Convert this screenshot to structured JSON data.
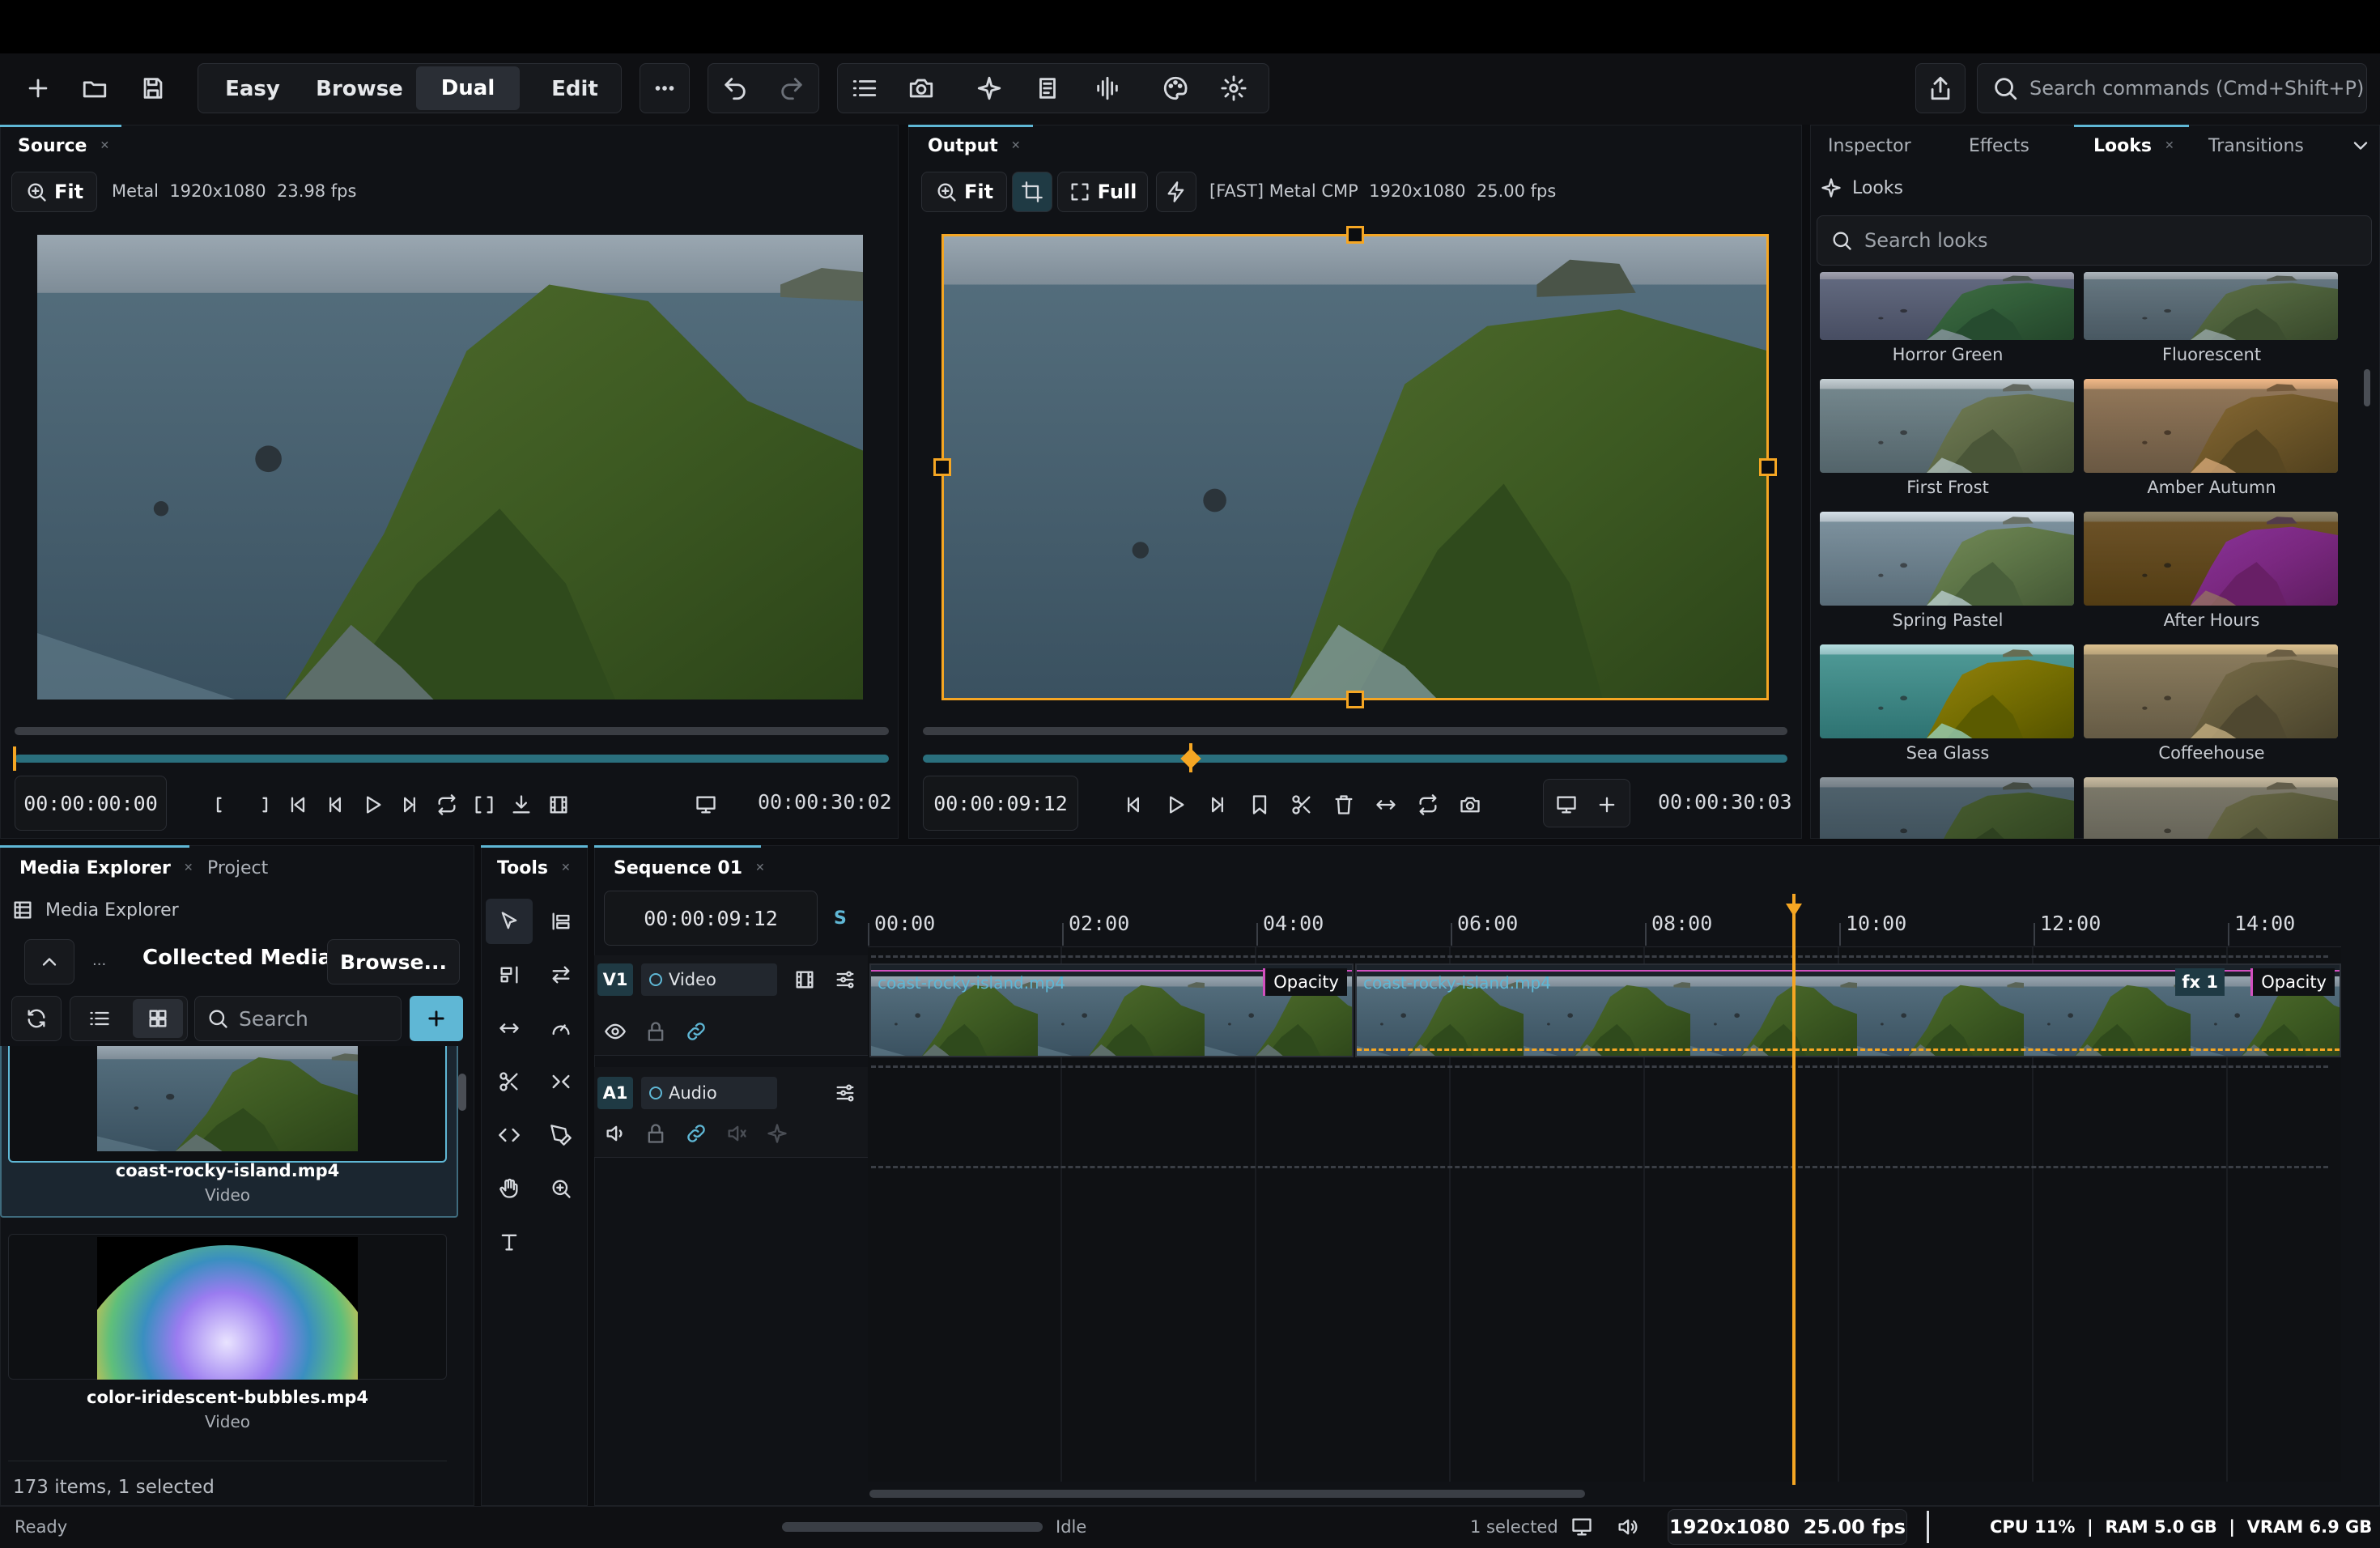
{
  "toolbar": {
    "modes": [
      "Easy",
      "Browse",
      "Dual",
      "Edit"
    ],
    "active_mode": "Dual",
    "search_placeholder": "Search commands (Cmd+Shift+P)"
  },
  "source": {
    "tab": "Source",
    "zoom": "Fit",
    "info": "Metal  1920x1080  23.98 fps",
    "timecode_in": "00:00:00:00",
    "timecode_out": "00:00:30:02"
  },
  "output": {
    "tab": "Output",
    "zoom": "Fit",
    "full": "Full",
    "info": "[FAST] Metal CMP  1920x1080  25.00 fps",
    "timecode_in": "00:00:09:12",
    "timecode_out": "00:00:30:03",
    "playhead_fraction": 0.31
  },
  "right_panel": {
    "tabs": [
      "Inspector",
      "Effects",
      "Looks",
      "Transitions"
    ],
    "active_tab": "Looks",
    "header": "Looks",
    "search_placeholder": "Search looks",
    "looks": [
      "Horror Green",
      "Fluorescent",
      "First Frost",
      "Amber Autumn",
      "Spring Pastel",
      "After Hours",
      "Sea Glass",
      "Coffeehouse"
    ]
  },
  "media": {
    "tabs": [
      "Media Explorer",
      "Project"
    ],
    "header": "Media Explorer",
    "breadcrumb_ellipsis": "...",
    "collection": "Collected Media",
    "browse": "Browse...",
    "search_placeholder": "Search",
    "items": [
      {
        "name": "coast-rocky-island.mp4",
        "type": "Video"
      },
      {
        "name": "color-iridescent-bubbles.mp4",
        "type": "Video"
      }
    ],
    "footer": "173 items, 1 selected"
  },
  "tools": {
    "tab": "Tools"
  },
  "timeline": {
    "tab": "Sequence 01",
    "timecode": "00:00:09:12",
    "snap": "S",
    "ruler": [
      "00:00",
      "02:00",
      "04:00",
      "06:00",
      "08:00",
      "10:00",
      "12:00",
      "14:00"
    ],
    "tracks": [
      {
        "id": "V1",
        "name": "Video"
      },
      {
        "id": "A1",
        "name": "Audio"
      }
    ],
    "clips": [
      {
        "name": "coast-rocky-island.mp4",
        "badge": "Opacity"
      },
      {
        "name": "coast-rocky-island.mp4",
        "fx": "fx 1",
        "badge": "Opacity"
      }
    ]
  },
  "status": {
    "left": "Ready",
    "progress": "Idle",
    "selected": "1 selected",
    "format": "1920x1080  25.00 fps",
    "resources": "CPU 11%  |  RAM 5.0 GB  |  VRAM 6.9 GB"
  },
  "colors": {
    "accent": "#f5a623",
    "teal": "#2a6f7d",
    "selection": "#5fb7d5",
    "bg": "#0c0d10"
  }
}
